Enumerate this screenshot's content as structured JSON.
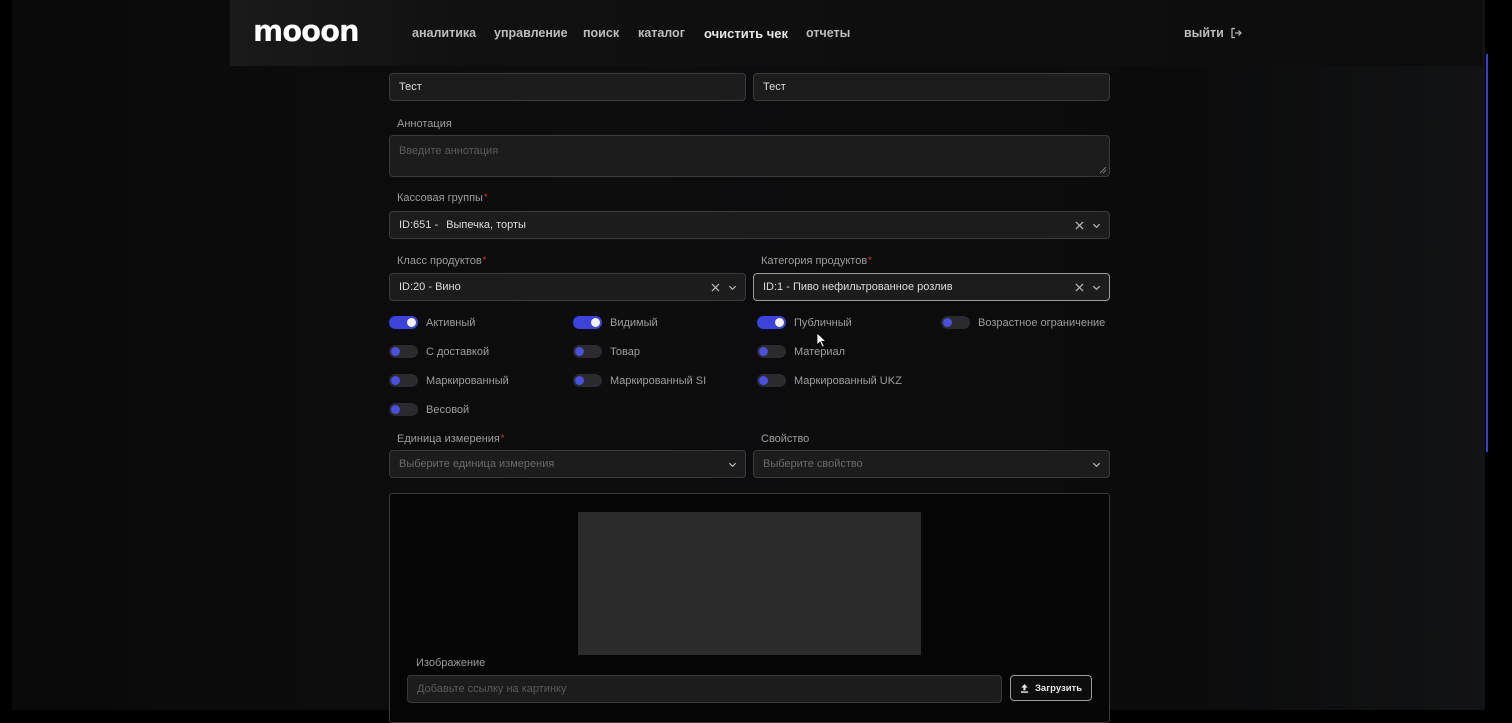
{
  "header": {
    "logo": "mooon",
    "nav": [
      "аналитика",
      "управление",
      "поиск",
      "каталог",
      "очистить чек",
      "отчеты"
    ],
    "logout": "выйти"
  },
  "form": {
    "name_value_1": "Тест",
    "name_value_2": "Тест",
    "annotation": {
      "label": "Аннотация",
      "placeholder": "Введите аннотация"
    },
    "cash_group": {
      "label": "Кассовая группы",
      "value_id": "ID:651 -",
      "value_name": "Выпечка, торты"
    },
    "product_class": {
      "label": "Класс продуктов",
      "value": "ID:20 - Вино"
    },
    "product_category": {
      "label": "Категория продуктов",
      "value": "ID:1 - Пиво нефильтрованное розлив"
    },
    "toggles": [
      {
        "label": "Активный",
        "on": true
      },
      {
        "label": "Видимый",
        "on": true
      },
      {
        "label": "Публичный",
        "on": true
      },
      {
        "label": "Возрастное ограничение",
        "on": false
      },
      {
        "label": "С доставкой",
        "on": false
      },
      {
        "label": "Товар",
        "on": false
      },
      {
        "label": "Материал",
        "on": false
      },
      {
        "label": "Маркированный",
        "on": false
      },
      {
        "label": "Маркированный SI",
        "on": false
      },
      {
        "label": "Маркированный UKZ",
        "on": false
      },
      {
        "label": "Весовой",
        "on": false
      }
    ],
    "unit": {
      "label": "Единица измерения",
      "placeholder": "Выберите единица измерения"
    },
    "property": {
      "label": "Свойство",
      "placeholder": "Выберите свойство"
    },
    "image": {
      "label": "Изображение",
      "placeholder": "Добавьте ссылку на картинку",
      "upload": "Загрузить"
    }
  },
  "colors": {
    "accent": "#3d43d6",
    "background": "#000000",
    "field": "#1c1c1c"
  }
}
